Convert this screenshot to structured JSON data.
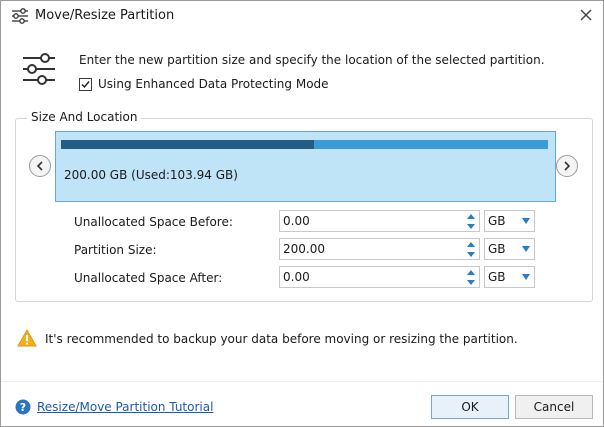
{
  "window": {
    "title": "Move/Resize Partition"
  },
  "intro": {
    "text": "Enter the new partition size and specify the location of the selected partition.",
    "checkbox_label": "Using Enhanced Data Protecting Mode",
    "checkbox_checked": true
  },
  "size_location": {
    "group_title": "Size And Location",
    "disk_label": "200.00 GB (Used:103.94 GB)",
    "used_fraction": 0.52,
    "fields": [
      {
        "label": "Unallocated Space Before:",
        "value": "0.00",
        "unit": "GB"
      },
      {
        "label": "Partition Size:",
        "value": "200.00",
        "unit": "GB"
      },
      {
        "label": "Unallocated Space After:",
        "value": "0.00",
        "unit": "GB"
      }
    ]
  },
  "warning": {
    "text": "It's recommended to backup your data before moving or resizing the partition."
  },
  "footer": {
    "help_link": "Resize/Move Partition Tutorial",
    "ok_label": "OK",
    "cancel_label": "Cancel"
  },
  "colors": {
    "disk_used": "#235d86",
    "disk_free": "#3a9bd6",
    "disk_panel": "#bfe3f7",
    "link": "#1c5aa8",
    "warning": "#f2b01e"
  },
  "icons": {
    "title": "sliders-icon",
    "header": "sliders-icon",
    "close": "close-icon",
    "nav_left": "chevron-left-icon",
    "nav_right": "chevron-right-icon",
    "warning": "warning-triangle-icon",
    "help": "help-icon"
  }
}
